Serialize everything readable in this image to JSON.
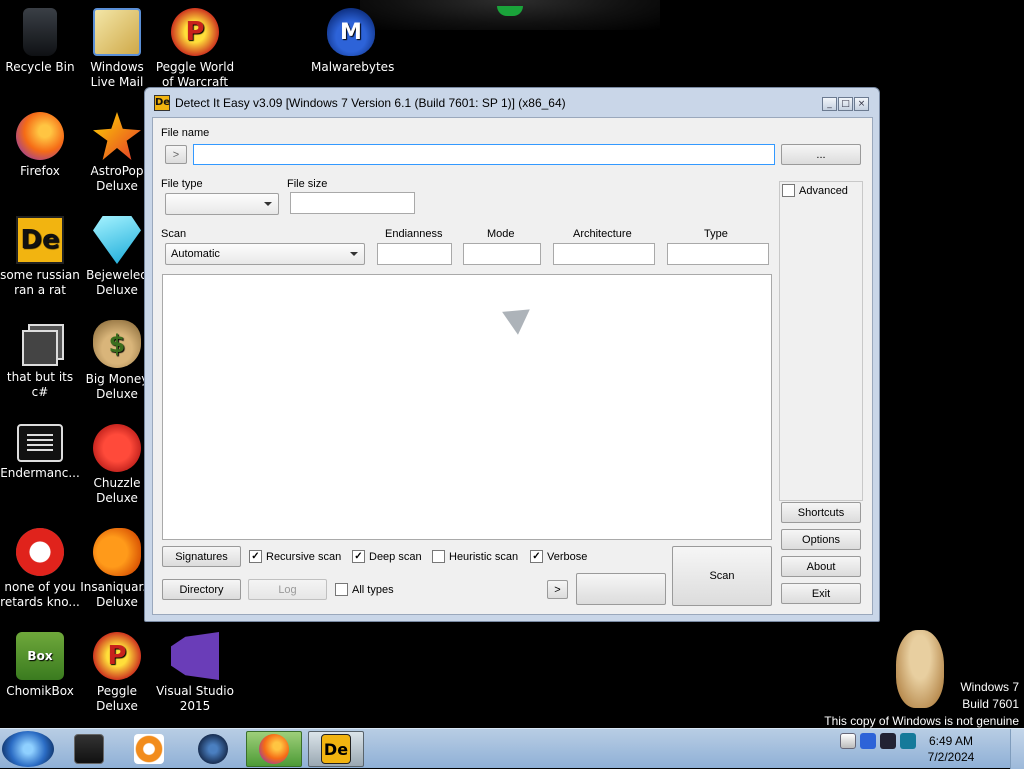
{
  "desktop": {
    "icons": [
      {
        "label": "Recycle Bin"
      },
      {
        "label": "Windows Live Mail"
      },
      {
        "label": "Peggle World of Warcraft ..."
      },
      {
        "label": "Malwarebytes"
      },
      {
        "label": "Firefox"
      },
      {
        "label": "AstroPop Deluxe"
      },
      {
        "label": "some russian ran a rat"
      },
      {
        "label": "Bejeweled Deluxe"
      },
      {
        "label": "that but its c#"
      },
      {
        "label": "Big Money Deluxe"
      },
      {
        "label": "Endermanc..."
      },
      {
        "label": "Chuzzle Deluxe"
      },
      {
        "label": "none of you retards kno..."
      },
      {
        "label": "Insaniquar... Deluxe"
      },
      {
        "label": "ChomikBox"
      },
      {
        "label": "Peggle Deluxe"
      },
      {
        "label": "Visual Studio 2015"
      }
    ],
    "watermark": {
      "line1": "Windows 7",
      "line2": "Build 7601",
      "line3": "This copy of Windows is not genuine"
    }
  },
  "window": {
    "title": "Detect It Easy v3.09 [Windows 7 Version 6.1 (Build 7601: SP 1)] (x86_64)",
    "app_icon_text": "De",
    "controls": {
      "minimize": "_",
      "maximize": "□",
      "close": "×"
    },
    "file_name_label": "File name",
    "file_name_value": "",
    "arrow_button": ">",
    "browse_button": "...",
    "file_type_label": "File type",
    "file_type_value": "",
    "file_size_label": "File size",
    "file_size_value": "",
    "advanced_label": "Advanced",
    "scan_label": "Scan",
    "scan_value": "Automatic",
    "endianness_label": "Endianness",
    "endianness_value": "",
    "mode_label": "Mode",
    "mode_value": "",
    "architecture_label": "Architecture",
    "architecture_value": "",
    "type_label": "Type",
    "type_value": "",
    "right_buttons": {
      "shortcuts": "Shortcuts",
      "options": "Options",
      "about": "About",
      "exit": "Exit"
    },
    "bottom": {
      "signatures": "Signatures",
      "recursive_scan": {
        "label": "Recursive scan",
        "checked": true
      },
      "deep_scan": {
        "label": "Deep scan",
        "checked": true
      },
      "heuristic_scan": {
        "label": "Heuristic scan",
        "checked": false
      },
      "verbose": {
        "label": "Verbose",
        "checked": true
      },
      "directory": "Directory",
      "log": "Log",
      "all_types": {
        "label": "All types",
        "checked": false
      },
      "next_arrow": ">",
      "scan_button": "Scan"
    }
  },
  "taskbar": {
    "time": "6:49 AM",
    "date": "7/2/2024"
  },
  "colors": {
    "window_frame": "#c9d6e8",
    "taskbar": "#9fbcdd",
    "input_focus": "#3399ff"
  }
}
